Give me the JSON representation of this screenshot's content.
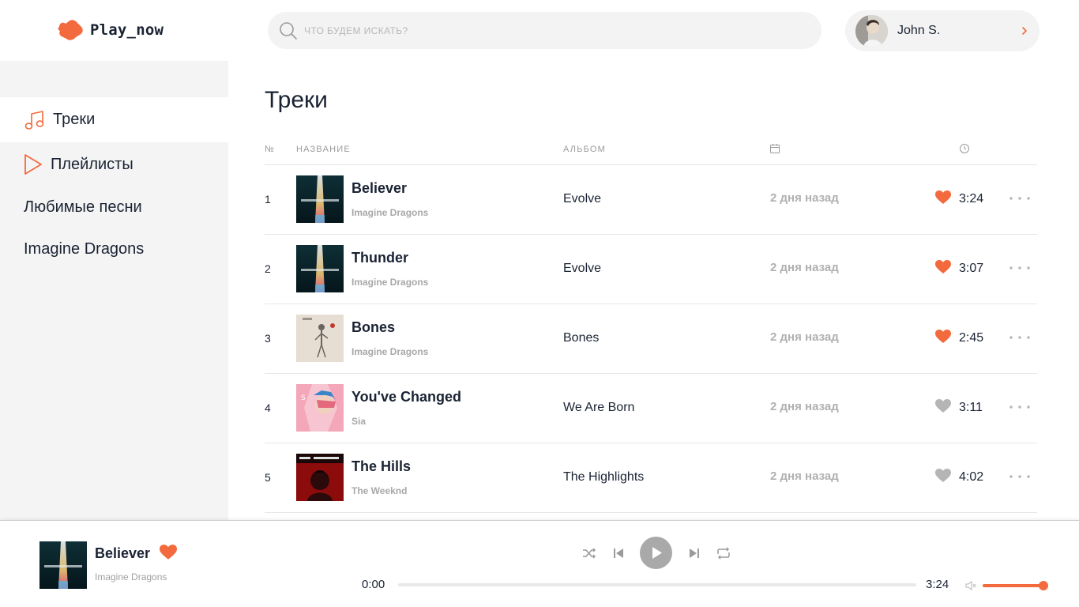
{
  "colors": {
    "accent": "#f26a3d",
    "text": "#1a2333",
    "muted": "#a8a8a8",
    "heart_inactive": "#b5b5b5",
    "sidebar_bg": "#f4f4f4"
  },
  "logo": {
    "text": "Play_now"
  },
  "search": {
    "placeholder": "ЧТО БУДЕМ ИСКАТЬ?",
    "value": ""
  },
  "user": {
    "name": "John S."
  },
  "sidebar": {
    "items": [
      {
        "label": "Треки",
        "icon": "music-note-icon",
        "active": true
      },
      {
        "label": "Плейлисты",
        "icon": "play-icon",
        "active": false
      },
      {
        "label": "Любимые песни",
        "icon": "",
        "active": false
      },
      {
        "label": "Imagine Dragons",
        "icon": "",
        "active": false
      }
    ]
  },
  "main": {
    "title": "Треки",
    "columns": {
      "num": "№",
      "name": "НАЗВАНИЕ",
      "album": "АЛЬБОМ",
      "date_icon": "calendar-icon",
      "duration_icon": "clock-icon"
    },
    "tracks": [
      {
        "num": "1",
        "title": "Believer",
        "artist": "Imagine Dragons",
        "album": "Evolve",
        "added": "2 дня назад",
        "liked": true,
        "duration": "3:24",
        "cover": "evolve"
      },
      {
        "num": "2",
        "title": "Thunder",
        "artist": "Imagine Dragons",
        "album": "Evolve",
        "added": "2 дня назад",
        "liked": true,
        "duration": "3:07",
        "cover": "evolve"
      },
      {
        "num": "3",
        "title": "Bones",
        "artist": "Imagine Dragons",
        "album": "Bones",
        "added": "2 дня назад",
        "liked": true,
        "duration": "2:45",
        "cover": "bones"
      },
      {
        "num": "4",
        "title": "You've Changed",
        "artist": "Sia",
        "album": "We Are Born",
        "added": "2 дня назад",
        "liked": false,
        "duration": "3:11",
        "cover": "we-are-born"
      },
      {
        "num": "5",
        "title": "The Hills",
        "artist": "The Weeknd",
        "album": "The Highlights",
        "added": "2 дня назад",
        "liked": false,
        "duration": "4:02",
        "cover": "highlights"
      }
    ]
  },
  "player": {
    "title": "Believer",
    "artist": "Imagine Dragons",
    "liked": true,
    "current_time": "0:00",
    "total_time": "3:24",
    "progress_fraction": 0,
    "volume_fraction": 1.0,
    "controls": [
      "shuffle-icon",
      "previous-icon",
      "play-icon",
      "next-icon",
      "repeat-icon"
    ]
  }
}
